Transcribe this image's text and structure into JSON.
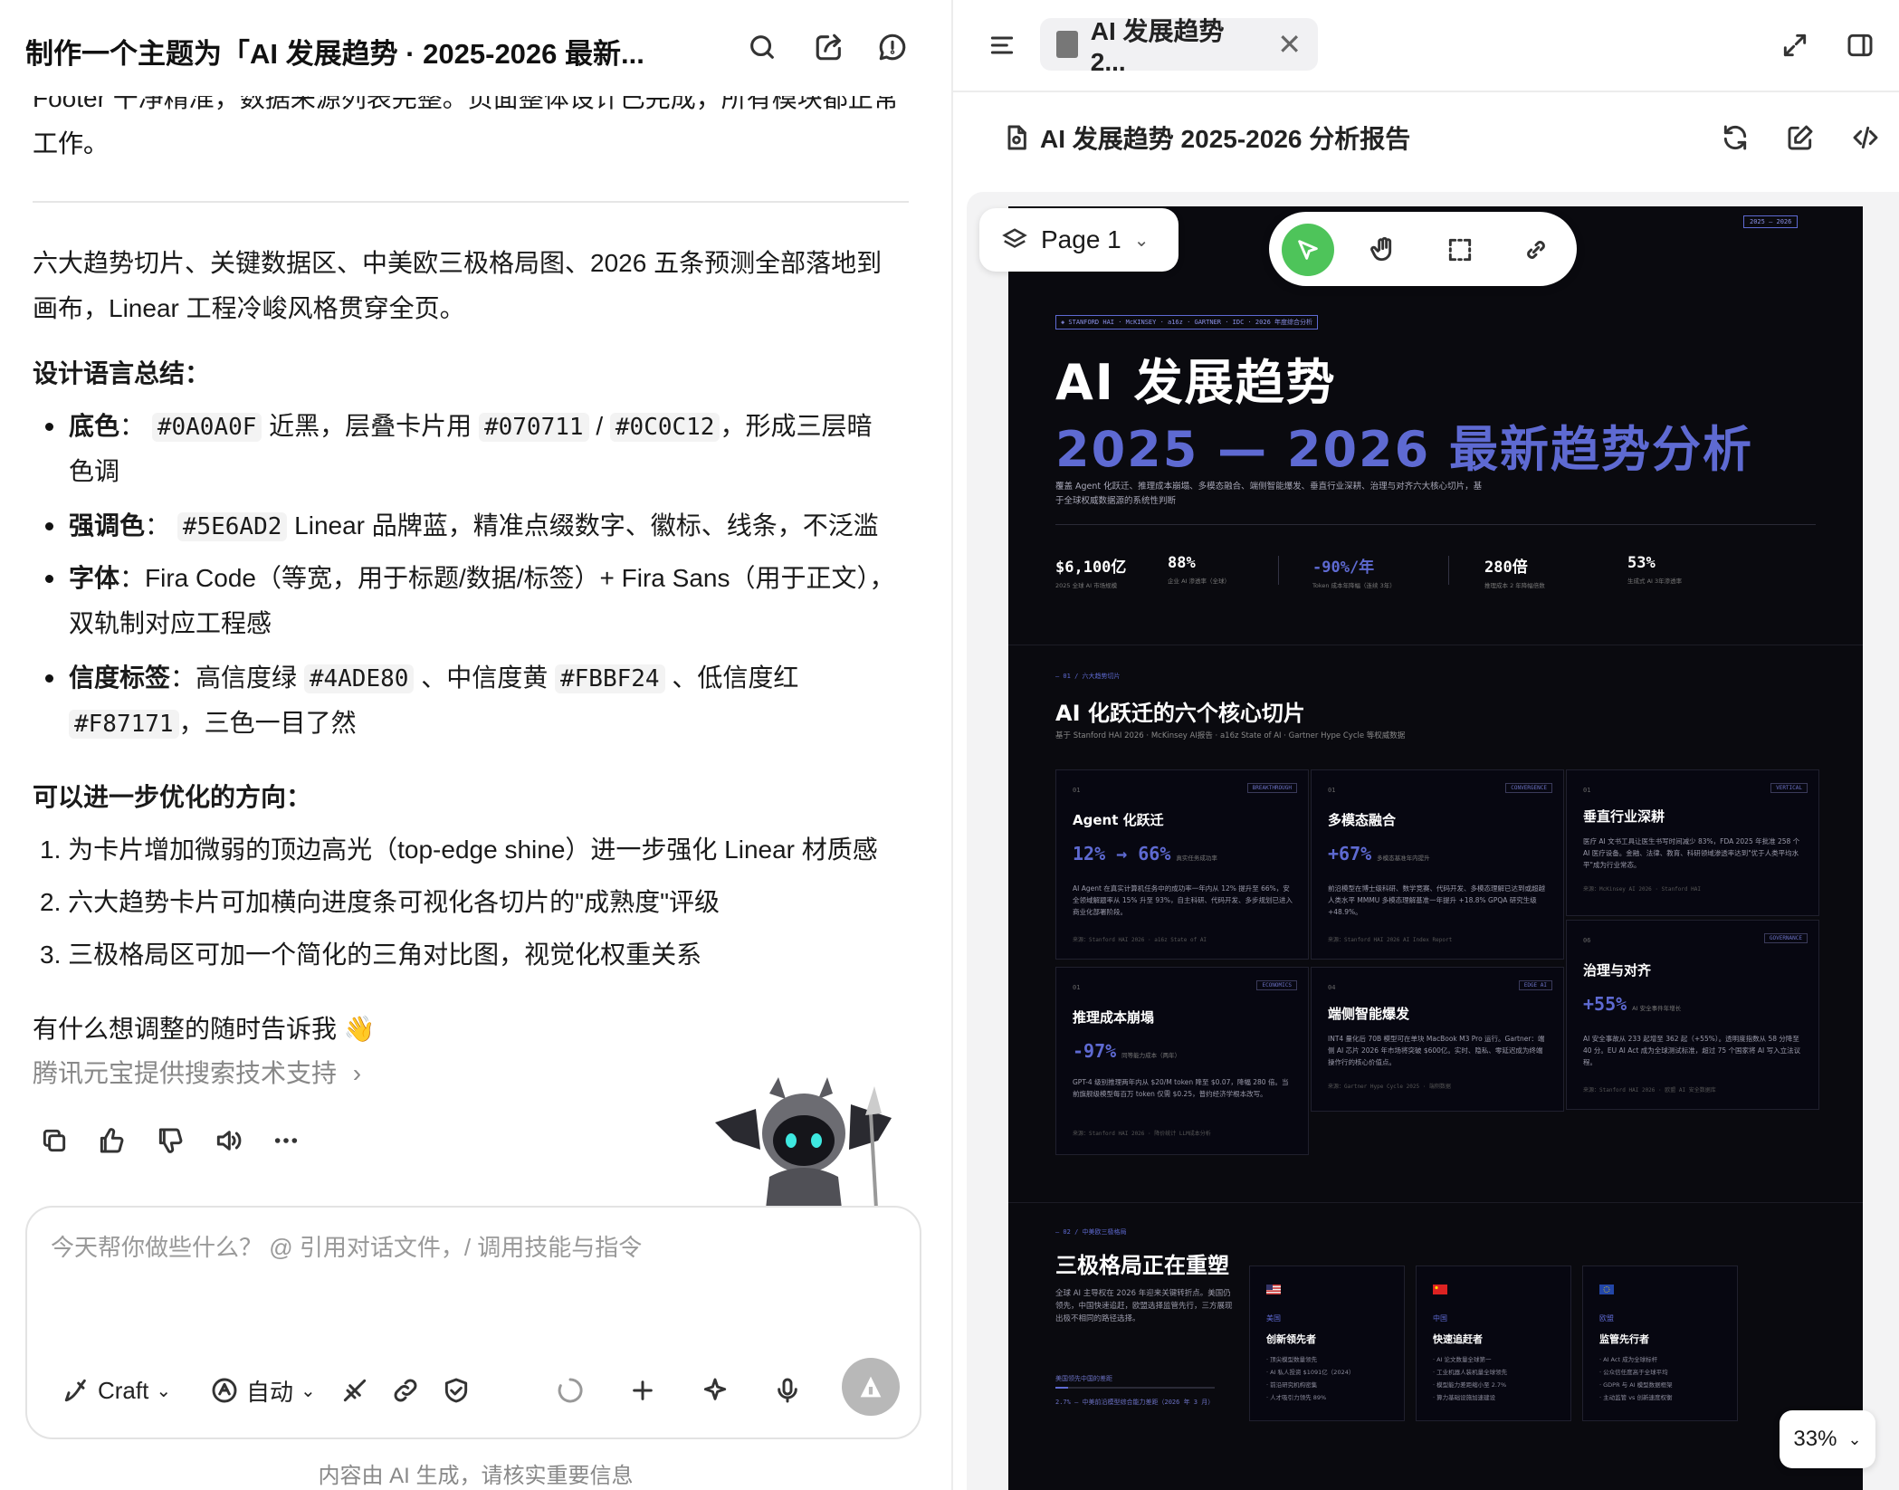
{
  "left_panel": {
    "title": "制作一个主题为「AI 发展趋势 · 2025-2026 最新...",
    "cut_line": "Footer 干净精准，数据来源列表完整。页面整体设计已完成，所有模块都正常",
    "cut_line_2": "工作。",
    "summary_p1": "六大趋势切片、关键数据区、中美欧三极格局图、2026 五条预测全部落地到",
    "summary_p2": "画布，Linear 工程冷峻风格贯穿全页。",
    "design_heading": "设计语言总结：",
    "bullet1": {
      "label": "底色",
      "sep": "：",
      "code1": "#0A0A0F",
      "text1": "近黑，层叠卡片用",
      "code2": "#070711",
      "slash": "/",
      "code3": "#0C0C12",
      "text2": "，形成三层暗",
      "text3": "色调"
    },
    "bullet2": {
      "label": "强调色",
      "sep": "：",
      "code": "#5E6AD2",
      "text": "Linear 品牌蓝，精准点缀数字、徽标、线条，不泛滥"
    },
    "bullet3": {
      "label": "字体",
      "sep": "：",
      "text": "Fira Code（等宽，用于标题/数据/标签）+ Fira Sans（用于正文），",
      "text2": "双轨制对应工程感"
    },
    "bullet4": {
      "label": "信度标签",
      "sep": "：",
      "t1": "高信度绿",
      "c1": "#4ADE80",
      "t2": "、中信度黄",
      "c2": "#FBBF24",
      "t3": "、低信度红",
      "c3": "#F87171",
      "t4": "，三色一目了然"
    },
    "improve_heading": "可以进一步优化的方向：",
    "improve_items": [
      "1. 为卡片增加微弱的顶边高光（top-edge shine）进一步强化 Linear 材质感",
      "2. 六大趋势卡片可加横向进度条可视化各切片的\"成熟度\"评级",
      "3. 三极格局区可加一个简化的三角对比图，视觉化权重关系"
    ],
    "closing": "有什么想调整的随时告诉我 👋",
    "source_link": "腾讯元宝提供搜索技术支持",
    "input_placeholder": "今天帮你做些什么？ @ 引用对话文件，/ 调用技能与指令",
    "mode_craft": "Craft",
    "mode_auto": "自动",
    "footer_note": "内容由 AI 生成，请核实重要信息"
  },
  "right_panel": {
    "tab_label": "AI 发展趋势 2...",
    "doc_title": "AI 发展趋势 2025-2026 分析报告",
    "page_selector": "Page 1",
    "zoom": "33%"
  },
  "canvas": {
    "top_mark": "RT",
    "year_badge": "2025 — 2026",
    "sources_tag": "◈ STANFORD HAI · McKINSEY · a16z · GARTNER · IDC · 2026 年度综合分析",
    "title_line1": "AI 发展趋势",
    "title_line2": "2025 — 2026  最新趋势分析",
    "intro": "覆盖 Agent 化跃迁、推理成本崩塌、多模态融合、端侧智能爆发、垂直行业深耕、治理与对齐六大核心切片，基于全球权威数据源的系统性判断",
    "stats": [
      {
        "value": "$6,100亿",
        "label": "2025 全球 AI 市场规模"
      },
      {
        "value": "88%",
        "label": "企业 AI 渗透率（全球）"
      },
      {
        "value": "-90%/年",
        "label": "Token 成本年降幅（连续 3年）"
      },
      {
        "value": "280倍",
        "label": "推理成本 2 年降幅倍数"
      },
      {
        "value": "53%",
        "label": "生成式 AI 3年渗透率"
      }
    ],
    "section1": {
      "kicker": "— 01 / 六大趋势切片",
      "title": "AI 化跃迁的六个核心切片",
      "subtitle": "基于 Stanford HAI 2026 · McKinsey AI报告 · a16z State of AI · Gartner Hype Cycle 等权威数据"
    },
    "cards": [
      {
        "num": "01",
        "badge": "BREAKTHROUGH",
        "title": "Agent 化跃迁",
        "metric": "12% → 66%",
        "metric_note": "真实任务成功率",
        "desc": "AI Agent 在真实计算机任务中的成功率一年内从 12% 提升至 66%，安全领域解题率从 15% 升至 93%，自主科研、代码开发、多步规划已进入商业化部署阶段。",
        "source": "来源：Stanford HAI 2026 · a16z State of AI"
      },
      {
        "num": "01",
        "badge": "CONVERGENCE",
        "title": "多模态融合",
        "metric": "+67%",
        "metric_note": "多模态基准年内提升",
        "desc": "前沿模型在博士级科研、数学竞赛、代码开发、多模态理解已达到或超越人类水平 MMMU 多模态理解基准一年提升 +18.8% GPQA 研究生级 +48.9%。",
        "source": "来源：Stanford HAI 2026 AI Index Report"
      },
      {
        "num": "01",
        "badge": "VERTICAL",
        "title": "垂直行业深耕",
        "metric": "",
        "metric_note": "",
        "desc": "医疗 AI 文书工具让医生书写时间减少 83%，FDA 2025 年批准 258 个 AI 医疗设备。金融、法律、教育、科研领域渗透率达到\"优于人类平均水平\"成为行业常态。",
        "source": "来源：McKinsey AI 2026 · Stanford HAI"
      },
      {
        "num": "01",
        "badge": "ECONOMICS",
        "title": "推理成本崩塌",
        "metric": "-97%",
        "metric_note": "同等能力成本（两年）",
        "desc": "GPT-4 级别推理两年内从 $20/M token 降至 $0.07，降幅 280 倍。当前旗舰级模型每百万 token 仅需 $0.25，普约经济学根本改写。",
        "source": "来源：Stanford HAI 2026 · 降价统计 LLM成本分析"
      },
      {
        "num": "04",
        "badge": "EDGE AI",
        "title": "端侧智能爆发",
        "metric": "",
        "metric_note": "",
        "desc": "INT4 量化后 70B 模型可在单块 MacBook M3 Pro 运行。Gartner：端侧 AI 芯片 2026 年市场将突破 $600亿。实时、隐私、零延迟成为终端操作行的核心价值点。",
        "source": "来源：Gartner Hype Cycle 2025 · 端侧数据"
      },
      {
        "num": "06",
        "badge": "GOVERNANCE",
        "title": "治理与对齐",
        "metric": "+55%",
        "metric_note": "AI 安全事件年增长",
        "desc": "AI 安全事故从 233 起增至 362 起（+55%）。透明度指数从 58 分降至 40 分。EU AI Act 成为全球测试标准，超过 75 个国家将 AI 写入立法议程。",
        "source": "来源：Stanford HAI 2026 · 欧盟 AI 安全数据库"
      }
    ],
    "section2": {
      "kicker": "— 02 / 中美欧三极格局",
      "title": "三极格局正在重塑",
      "desc": "全球 AI 主导权在 2026 年迎来关键转折点。美国仍领先，中国快速追赶，欧盟选择监管先行，三方展现出极不相同的路径选择。",
      "bar_label": "美国领先中国的差距",
      "bar_caption": "2.7%  — 中美前沿模型综合能力差距（2026 年 3 月）",
      "poles": [
        {
          "flag": "us",
          "region": "美国",
          "role": "创新领先者",
          "items": [
            "· 顶尖模型数量领先",
            "· AI 私人投资 $1091亿（2024）",
            "· 前沿研究机构密集",
            "· 人才吸引力领先 89%"
          ]
        },
        {
          "flag": "cn",
          "region": "中国",
          "role": "快速追赶者",
          "items": [
            "· AI 论文数量全球第一",
            "· 工业机器人装机量全球领先",
            "· 模型能力差距缩小至 2.7%",
            "· 算力基础设施加速建设"
          ]
        },
        {
          "flag": "eu",
          "region": "欧盟",
          "role": "监管先行者",
          "items": [
            "· AI Act 成为全球标杆",
            "· 公众信任度高于全球平均",
            "· GDPR 与 AI 模型数据框架",
            "· 主动监管 vs 创新速度权衡"
          ]
        }
      ]
    }
  }
}
